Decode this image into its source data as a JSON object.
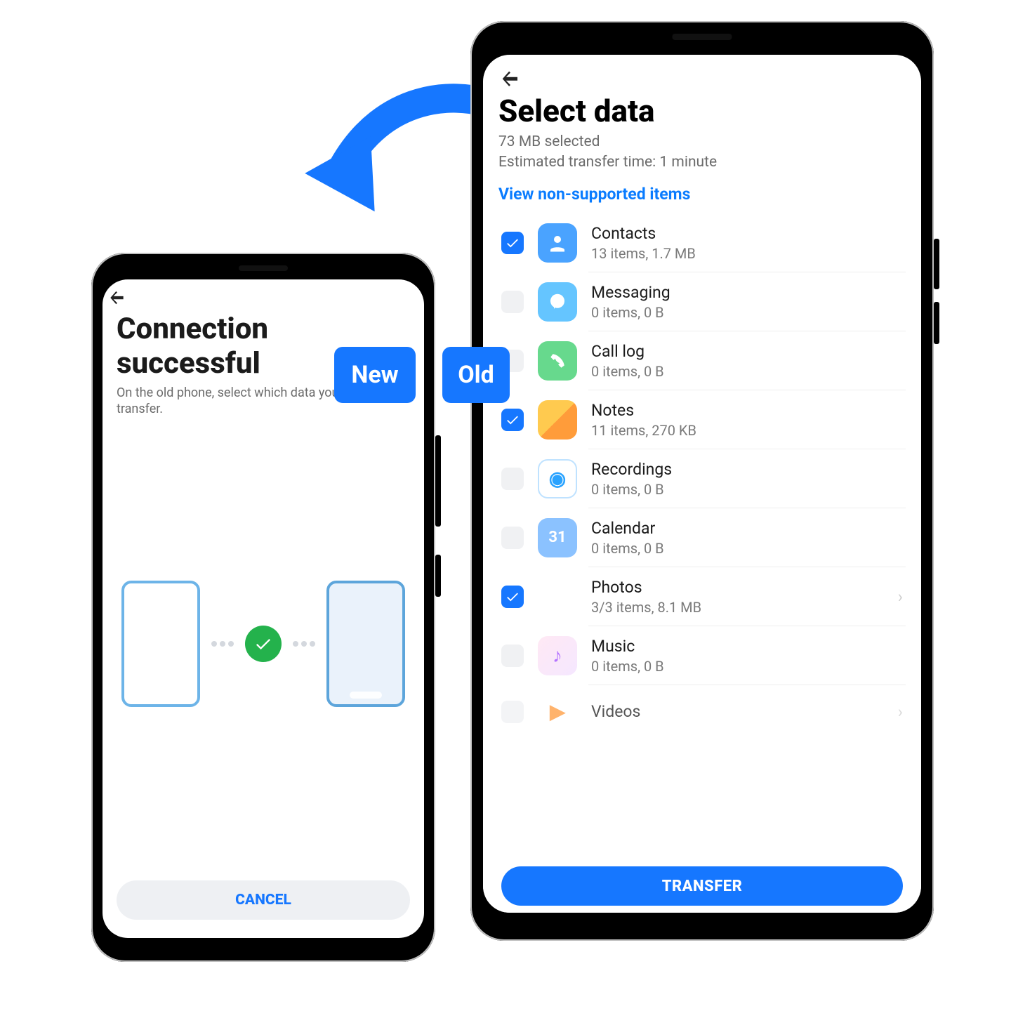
{
  "left": {
    "title": "Connection successful",
    "subtitle": "On the old phone, select which data you want to transfer.",
    "cancel": "CANCEL"
  },
  "right": {
    "title": "Select data",
    "selected_line": "73 MB selected",
    "estimate_line": "Estimated transfer time: 1 minute",
    "view_unsupported": "View non-supported items",
    "transfer": "TRANSFER",
    "items": [
      {
        "name": "Contacts",
        "desc": "13 items, 1.7 MB",
        "checked": true,
        "icon": "contacts"
      },
      {
        "name": "Messaging",
        "desc": "0 items, 0 B",
        "checked": false,
        "icon": "msg"
      },
      {
        "name": "Call log",
        "desc": "0 items, 0 B",
        "checked": false,
        "icon": "call"
      },
      {
        "name": "Notes",
        "desc": "11 items, 270 KB",
        "checked": true,
        "icon": "notes"
      },
      {
        "name": "Recordings",
        "desc": "0 items, 0 B",
        "checked": false,
        "icon": "rec"
      },
      {
        "name": "Calendar",
        "desc": "0 items, 0 B",
        "checked": false,
        "icon": "cal"
      },
      {
        "name": "Photos",
        "desc": "3/3 items, 8.1 MB",
        "checked": true,
        "icon": "photos",
        "chevron": true
      },
      {
        "name": "Music",
        "desc": "0 items, 0 B",
        "checked": false,
        "icon": "music"
      },
      {
        "name": "Videos",
        "desc": "",
        "checked": false,
        "icon": "video",
        "chevron": true,
        "fade": true
      }
    ]
  },
  "badges": {
    "new": "New",
    "old": "Old"
  }
}
